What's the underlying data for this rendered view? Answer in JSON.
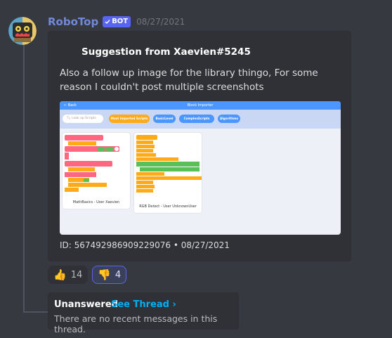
{
  "message": {
    "username": "RoboTop",
    "bot_badge": "BOT",
    "timestamp": "08/27/2021"
  },
  "embed": {
    "title": "Suggestion from Xaevien#5245",
    "description": "Also a follow up image for the library thingo, For some reason I couldn't post multiple screenshots",
    "footer": "ID: 567492986909229076 • 08/27/2021",
    "image": {
      "back": "Back",
      "title": "Block Importer",
      "search_placeholder": "Look up Scripts",
      "tabs": [
        "Most Imported Scripts",
        "BasicLevel",
        "ComplexScripts",
        "Algorithms"
      ],
      "cards": [
        "MathBasics - User Xaevien",
        "RGB Detect - User UnknownUser"
      ]
    }
  },
  "reactions": [
    {
      "emoji": "👍",
      "count": "14",
      "active": false
    },
    {
      "emoji": "👎",
      "count": "4",
      "active": true
    }
  ],
  "thread": {
    "name": "Unanswered",
    "link": "See Thread ›",
    "empty": "There are no recent messages in this thread."
  },
  "colors": {
    "username": "#7289da",
    "bot_badge": "#5865f2",
    "link": "#00aff4",
    "block_pink": "#ff6680",
    "block_orange": "#ffab19",
    "block_green": "#59c059"
  }
}
